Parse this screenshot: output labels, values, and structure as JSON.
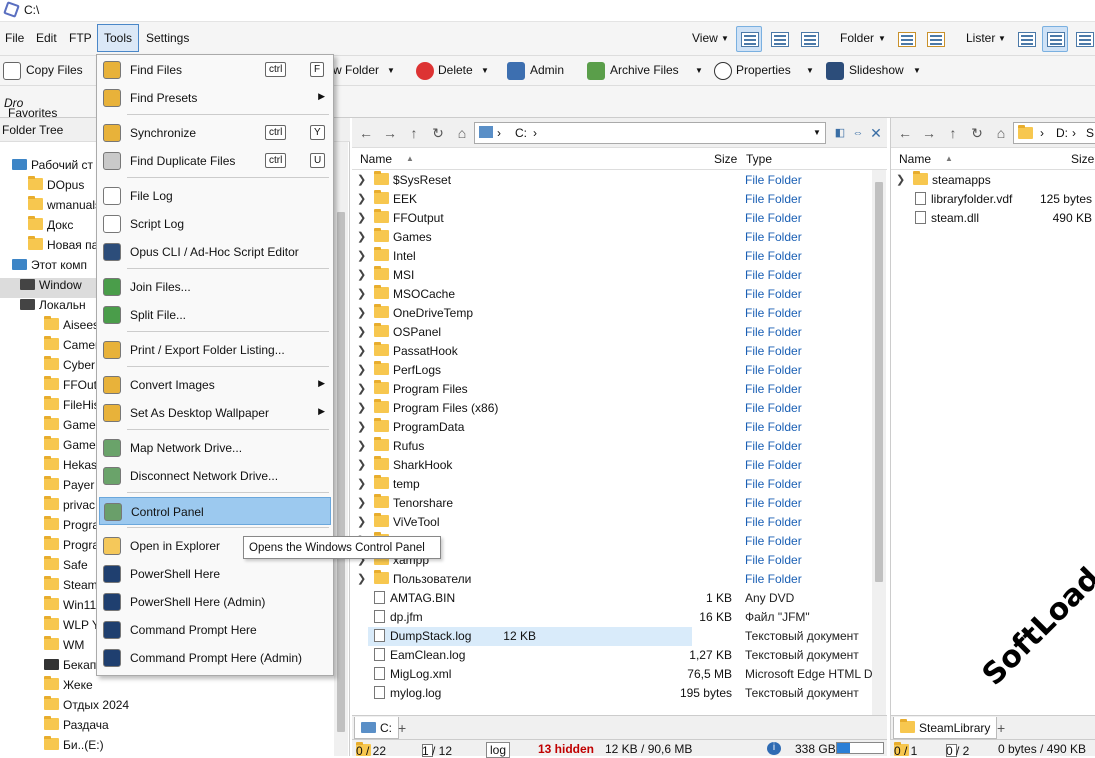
{
  "window": {
    "title": "C:\\"
  },
  "menubar": {
    "items": [
      "File",
      "Edit",
      "FTP",
      "Tools",
      "Settings"
    ],
    "view": "View",
    "folder": "Folder",
    "lister": "Lister"
  },
  "toolbar": {
    "copy_files": "Copy Files",
    "new_folder": "w Folder",
    "delete": "Delete",
    "admin": "Admin",
    "archive": "Archive Files",
    "properties": "Properties",
    "slideshow": "Slideshow"
  },
  "favbar": {
    "label": "Favorites Bar.",
    "trail": "Dro"
  },
  "tree": {
    "header": "Folder Tree",
    "items": [
      "Рабочий ст",
      "DOpus",
      "wmanuals",
      "Докс",
      "Новая па",
      "Этот комп",
      "Window",
      "Локальн",
      "Aisees",
      "Camer",
      "Cyber",
      "FFOut",
      "FileHis",
      "Game",
      "Games",
      "Hekas",
      "Payer",
      "privac",
      "Progra",
      "Progra",
      "Safe",
      "Steam",
      "Win11",
      "WLP Y",
      "WM",
      "Бекап",
      "Жеке",
      "Отдых 2024",
      "Раздача",
      "Би..(E:)"
    ]
  },
  "menu": {
    "items": [
      {
        "label": "Find Files",
        "kb": [
          "ctrl",
          "F"
        ]
      },
      {
        "label": "Find Presets",
        "sub": true
      },
      {
        "label": "Synchronize",
        "kb": [
          "ctrl",
          "Y"
        ]
      },
      {
        "label": "Find Duplicate Files",
        "kb": [
          "ctrl",
          "U"
        ]
      },
      {
        "label": "File Log"
      },
      {
        "label": "Script Log"
      },
      {
        "label": "Opus CLI / Ad-Hoc Script Editor"
      },
      {
        "label": "Join Files..."
      },
      {
        "label": "Split File..."
      },
      {
        "label": "Print / Export Folder Listing..."
      },
      {
        "label": "Convert Images",
        "sub": true
      },
      {
        "label": "Set As Desktop Wallpaper",
        "sub": true
      },
      {
        "label": "Map Network Drive..."
      },
      {
        "label": "Disconnect Network Drive..."
      },
      {
        "label": "Control Panel"
      },
      {
        "label": "Open in Explorer"
      },
      {
        "label": "PowerShell Here"
      },
      {
        "label": "PowerShell Here (Admin)"
      },
      {
        "label": "Command Prompt Here"
      },
      {
        "label": "Command Prompt Here (Admin)"
      }
    ],
    "tooltip": "Opens the Windows Control Panel"
  },
  "left": {
    "path": "C:",
    "cols": {
      "name": "Name",
      "size": "Size",
      "type": "Type"
    },
    "rows": [
      {
        "n": "$SysReset",
        "s": "",
        "t": "File Folder",
        "d": true
      },
      {
        "n": "EEK",
        "s": "",
        "t": "File Folder",
        "d": true
      },
      {
        "n": "FFOutput",
        "s": "",
        "t": "File Folder",
        "d": true
      },
      {
        "n": "Games",
        "s": "",
        "t": "File Folder",
        "d": true
      },
      {
        "n": "Intel",
        "s": "",
        "t": "File Folder",
        "d": true
      },
      {
        "n": "MSI",
        "s": "",
        "t": "File Folder",
        "d": true
      },
      {
        "n": "MSOCache",
        "s": "",
        "t": "File Folder",
        "d": true
      },
      {
        "n": "OneDriveTemp",
        "s": "",
        "t": "File Folder",
        "d": true
      },
      {
        "n": "OSPanel",
        "s": "",
        "t": "File Folder",
        "d": true
      },
      {
        "n": "PassatHook",
        "s": "",
        "t": "File Folder",
        "d": true
      },
      {
        "n": "PerfLogs",
        "s": "",
        "t": "File Folder",
        "d": true
      },
      {
        "n": "Program Files",
        "s": "",
        "t": "File Folder",
        "d": true
      },
      {
        "n": "Program Files (x86)",
        "s": "",
        "t": "File Folder",
        "d": true
      },
      {
        "n": "ProgramData",
        "s": "",
        "t": "File Folder",
        "d": true
      },
      {
        "n": "Rufus",
        "s": "",
        "t": "File Folder",
        "d": true
      },
      {
        "n": "SharkHook",
        "s": "",
        "t": "File Folder",
        "d": true
      },
      {
        "n": "temp",
        "s": "",
        "t": "File Folder",
        "d": true
      },
      {
        "n": "Tenorshare",
        "s": "",
        "t": "File Folder",
        "d": true
      },
      {
        "n": "ViVeTool",
        "s": "",
        "t": "File Folder",
        "d": true
      },
      {
        "n": "s",
        "s": "",
        "t": "File Folder",
        "d": true
      },
      {
        "n": "xampp",
        "s": "",
        "t": "File Folder",
        "d": true
      },
      {
        "n": "Пользователи",
        "s": "",
        "t": "File Folder",
        "d": true
      },
      {
        "n": "AMTAG.BIN",
        "s": "1 KB",
        "t": "Any DVD",
        "d": false
      },
      {
        "n": "dp.jfm",
        "s": "16 KB",
        "t": "Файл \"JFM\"",
        "d": false
      },
      {
        "n": "DumpStack.log",
        "s": "12 KB",
        "t": "Текстовый документ",
        "d": false
      },
      {
        "n": "EamClean.log",
        "s": "1,27 KB",
        "t": "Текстовый документ",
        "d": false
      },
      {
        "n": "MigLog.xml",
        "s": "76,5 MB",
        "t": "Microsoft Edge HTML D",
        "d": false
      },
      {
        "n": "mylog.log",
        "s": "195 bytes",
        "t": "Текстовый документ",
        "d": false
      }
    ],
    "tab": "C:",
    "status": {
      "sel": "0 / 22",
      "files": "1 / 12",
      "filter": "log",
      "hidden": "13 hidden",
      "size": "12 KB / 90,6 MB",
      "free": "338 GB"
    }
  },
  "right": {
    "path_a": "D:",
    "path_b": "S",
    "cols": {
      "name": "Name",
      "size": "Size"
    },
    "rows": [
      {
        "n": "steamapps",
        "s": "",
        "d": true
      },
      {
        "n": "libraryfolder.vdf",
        "s": "125 bytes",
        "d": false
      },
      {
        "n": "steam.dll",
        "s": "490 KB",
        "d": false
      }
    ],
    "tab": "SteamLibrary",
    "status": {
      "sel": "0 / 1",
      "files": "0 / 2",
      "size": "0 bytes / 490 KB"
    }
  },
  "watermark": "SoftLoad.Su",
  "colors": {
    "highlight": "#9cc9ef",
    "link": "#1a5fb4",
    "hidden": "#c00000"
  }
}
